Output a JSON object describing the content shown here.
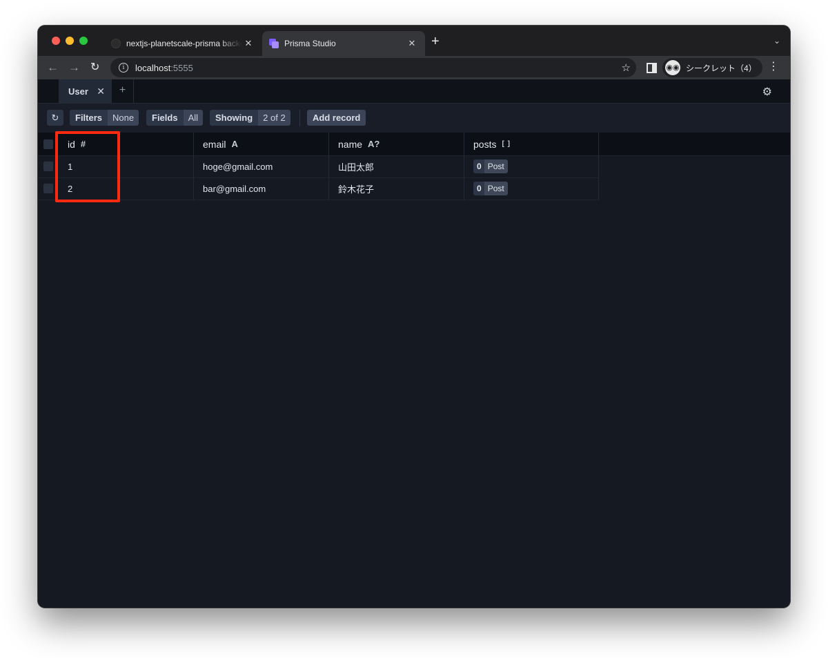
{
  "browser": {
    "tabs": [
      {
        "title": "nextjs-planetscale-prisma backend",
        "close": "✕",
        "active": false
      },
      {
        "title": "Prisma Studio",
        "close": "✕",
        "active": true
      }
    ],
    "new_tab": "+",
    "tab_search": "⌄",
    "url_host": "localhost",
    "url_port": ":5555",
    "incognito_label": "シークレット（4）",
    "icons": {
      "back": "←",
      "forward": "→",
      "reload": "↻",
      "info": "i",
      "star": "☆",
      "menu": "⋮"
    }
  },
  "studio": {
    "model_tabs": [
      {
        "label": "User",
        "close": "✕"
      }
    ],
    "add_tab": "+",
    "settings_icon": "⚙",
    "toolbar": {
      "refresh_icon": "↻",
      "filters_label": "Filters",
      "filters_value": "None",
      "fields_label": "Fields",
      "fields_value": "All",
      "showing_label": "Showing",
      "showing_value": "2 of 2",
      "add_record_label": "Add record"
    },
    "columns": [
      {
        "name": "id",
        "type_icon": "#"
      },
      {
        "name": "email",
        "type_icon": "A"
      },
      {
        "name": "name",
        "type_icon": "A?"
      },
      {
        "name": "posts",
        "type_icon": "[ ]"
      }
    ],
    "rows": [
      {
        "id": "1",
        "email": "hoge@gmail.com",
        "name": "山田太郎",
        "posts_count": "0",
        "posts_model": "Post"
      },
      {
        "id": "2",
        "email": "bar@gmail.com",
        "name": "鈴木花子",
        "posts_count": "0",
        "posts_model": "Post"
      }
    ]
  },
  "colors": {
    "highlight_box": "#ff2a0f",
    "studio_bg": "#151922",
    "accent_purple": "#7c5cff"
  }
}
